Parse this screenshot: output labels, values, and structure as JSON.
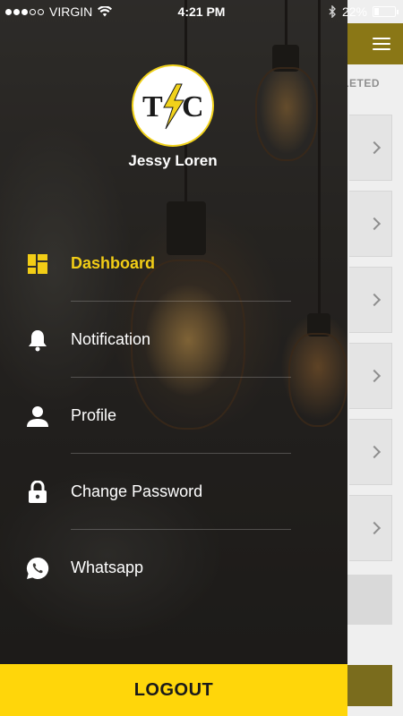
{
  "status_bar": {
    "carrier": "VIRGIN",
    "time": "4:21 PM",
    "battery_percent": "22%",
    "battery_level": 0.22
  },
  "profile": {
    "logo_text_left": "T",
    "logo_text_right": "C",
    "name": "Jessy Loren"
  },
  "menu": {
    "items": [
      {
        "label": "Dashboard",
        "icon": "dashboard-icon",
        "active": true
      },
      {
        "label": "Notification",
        "icon": "bell-icon",
        "active": false
      },
      {
        "label": "Profile",
        "icon": "person-icon",
        "active": false
      },
      {
        "label": "Change Password",
        "icon": "lock-icon",
        "active": false
      },
      {
        "label": "Whatsapp",
        "icon": "whatsapp-icon",
        "active": false
      }
    ]
  },
  "logout": {
    "label": "LOGOUT"
  },
  "background_screen": {
    "tab_partial": "LETED"
  },
  "colors": {
    "accent_yellow": "#ffd60a",
    "active_text": "#f2cd16",
    "topbar": "#8a7716"
  }
}
